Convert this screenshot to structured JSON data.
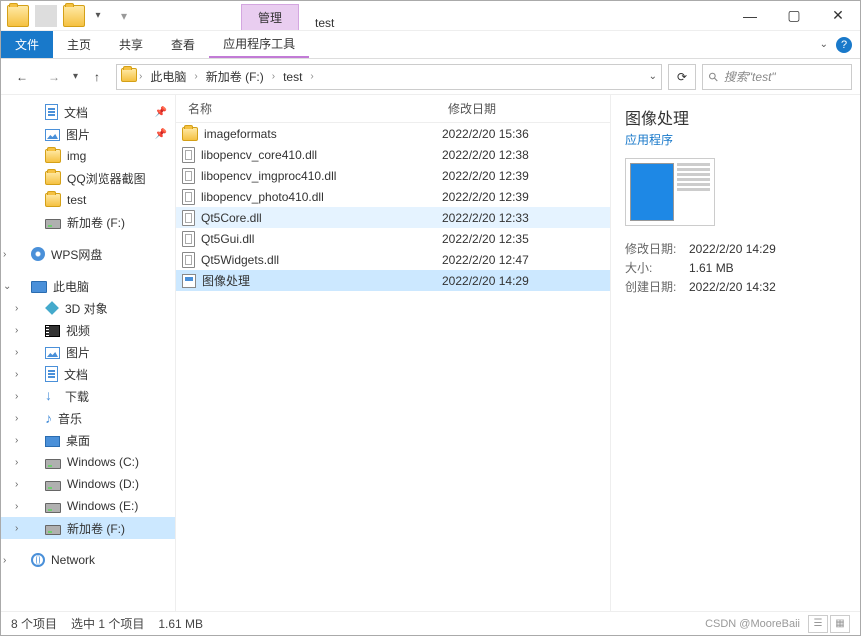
{
  "title": "test",
  "context_tab": "管理",
  "ribbon": {
    "file": "文件",
    "tabs": [
      "主页",
      "共享",
      "查看"
    ],
    "context_tool": "应用程序工具"
  },
  "address": {
    "crumbs": [
      "此电脑",
      "新加卷 (F:)",
      "test"
    ]
  },
  "search_placeholder": "搜索\"test\"",
  "nav_pane": {
    "quick_pinned": [
      {
        "label": "文档",
        "icon": "doc",
        "pinned": true
      },
      {
        "label": "图片",
        "icon": "pic",
        "pinned": true
      },
      {
        "label": "img",
        "icon": "folder"
      },
      {
        "label": "QQ浏览器截图",
        "icon": "folder"
      },
      {
        "label": "test",
        "icon": "folder"
      },
      {
        "label": "新加卷 (F:)",
        "icon": "disk"
      }
    ],
    "wps_label": "WPS网盘",
    "this_pc_label": "此电脑",
    "this_pc_items": [
      {
        "label": "3D 对象",
        "icon": "3d"
      },
      {
        "label": "视频",
        "icon": "video"
      },
      {
        "label": "图片",
        "icon": "pic"
      },
      {
        "label": "文档",
        "icon": "doc"
      },
      {
        "label": "下载",
        "icon": "down"
      },
      {
        "label": "音乐",
        "icon": "music"
      },
      {
        "label": "桌面",
        "icon": "desktop"
      },
      {
        "label": "Windows (C:)",
        "icon": "disk"
      },
      {
        "label": "Windows (D:)",
        "icon": "disk"
      },
      {
        "label": "Windows (E:)",
        "icon": "disk"
      },
      {
        "label": "新加卷 (F:)",
        "icon": "disk",
        "selected": true
      }
    ],
    "network_label": "Network"
  },
  "columns": {
    "name": "名称",
    "date": "修改日期"
  },
  "files": [
    {
      "name": "imageformats",
      "date": "2022/2/20 15:36",
      "type": "folder"
    },
    {
      "name": "libopencv_core410.dll",
      "date": "2022/2/20 12:38",
      "type": "dll"
    },
    {
      "name": "libopencv_imgproc410.dll",
      "date": "2022/2/20 12:39",
      "type": "dll"
    },
    {
      "name": "libopencv_photo410.dll",
      "date": "2022/2/20 12:39",
      "type": "dll"
    },
    {
      "name": "Qt5Core.dll",
      "date": "2022/2/20 12:33",
      "type": "dll",
      "highlighted": true
    },
    {
      "name": "Qt5Gui.dll",
      "date": "2022/2/20 12:35",
      "type": "dll"
    },
    {
      "name": "Qt5Widgets.dll",
      "date": "2022/2/20 12:47",
      "type": "dll"
    },
    {
      "name": "图像处理",
      "date": "2022/2/20 14:29",
      "type": "exe",
      "selected": true
    }
  ],
  "preview": {
    "title": "图像处理",
    "subtype": "应用程序",
    "details": [
      {
        "label": "修改日期:",
        "value": "2022/2/20 14:29"
      },
      {
        "label": "大小:",
        "value": "1.61 MB"
      },
      {
        "label": "创建日期:",
        "value": "2022/2/20 14:32"
      }
    ]
  },
  "status": {
    "items": "8 个项目",
    "selected": "选中 1 个项目",
    "size": "1.61 MB",
    "watermark": "CSDN @MooreBaii"
  }
}
